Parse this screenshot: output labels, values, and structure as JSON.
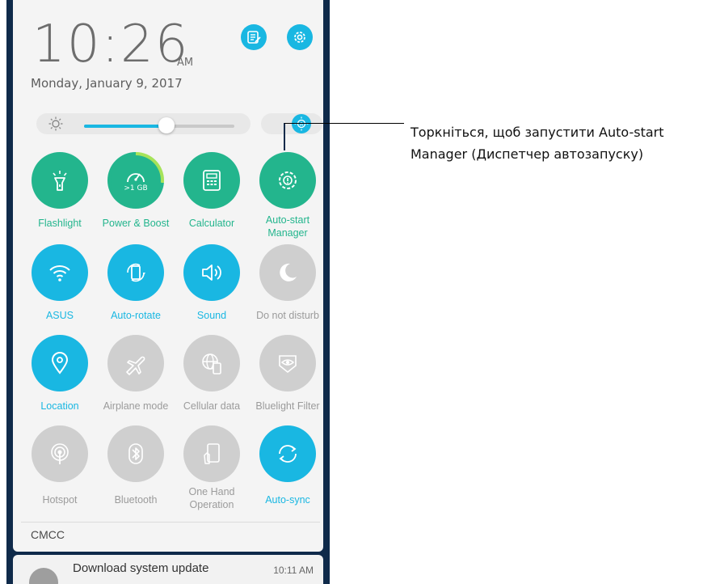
{
  "clock": {
    "time": "10:26",
    "ampm": "AM",
    "date": "Monday, January 9, 2017"
  },
  "header_buttons": [
    {
      "name": "edit-tiles-button",
      "icon": "edit-list-icon"
    },
    {
      "name": "settings-button",
      "icon": "gear-icon"
    }
  ],
  "brightness": {
    "level": 0.55,
    "auto_icon": "auto-brightness-icon"
  },
  "tiles": [
    {
      "label": "Flashlight",
      "state": "green",
      "icon": "flashlight-icon"
    },
    {
      "label": "Power & Boost",
      "state": "green",
      "icon": "boost-icon",
      "sub": ">1 GB"
    },
    {
      "label": "Calculator",
      "state": "green",
      "icon": "calculator-icon"
    },
    {
      "label": "Auto-start Manager",
      "state": "green",
      "icon": "auto-start-icon"
    },
    {
      "label": "ASUS",
      "state": "blue",
      "icon": "wifi-icon"
    },
    {
      "label": "Auto-rotate",
      "state": "blue",
      "icon": "rotate-icon"
    },
    {
      "label": "Sound",
      "state": "blue",
      "icon": "speaker-icon"
    },
    {
      "label": "Do not disturb",
      "state": "gray",
      "icon": "moon-icon"
    },
    {
      "label": "Location",
      "state": "blue",
      "icon": "location-icon"
    },
    {
      "label": "Airplane mode",
      "state": "gray",
      "icon": "airplane-icon"
    },
    {
      "label": "Cellular data",
      "state": "gray",
      "icon": "cellular-icon"
    },
    {
      "label": "Bluelight Filter",
      "state": "gray",
      "icon": "eye-icon"
    },
    {
      "label": "Hotspot",
      "state": "gray",
      "icon": "hotspot-icon"
    },
    {
      "label": "Bluetooth",
      "state": "gray",
      "icon": "bluetooth-icon"
    },
    {
      "label": "One Hand Operation",
      "state": "gray",
      "icon": "one-hand-icon"
    },
    {
      "label": "Auto-sync",
      "state": "blue",
      "icon": "sync-icon"
    }
  ],
  "carrier": "CMCC",
  "notification": {
    "title": "Download system update",
    "time": "10:11 AM"
  },
  "callout": "Торкніться, щоб запустити Auto-start Manager (Диспетчер автозапуску)",
  "colors": {
    "green": "#23b58d",
    "blue": "#19b7e2",
    "gray": "#cfcfcf",
    "dark": "#0f2a4a"
  }
}
